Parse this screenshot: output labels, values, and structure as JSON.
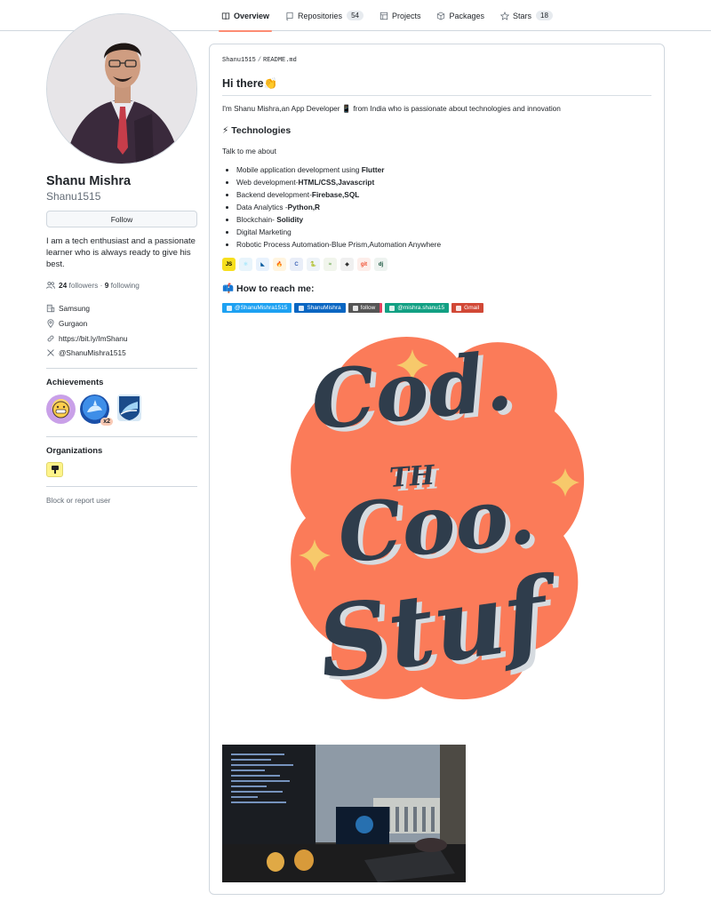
{
  "nav": {
    "tabs": [
      {
        "label": "Overview",
        "icon": "book-icon",
        "selected": true
      },
      {
        "label": "Repositories",
        "icon": "repo-icon",
        "count": "54"
      },
      {
        "label": "Projects",
        "icon": "table-icon"
      },
      {
        "label": "Packages",
        "icon": "package-icon"
      },
      {
        "label": "Stars",
        "icon": "star-icon",
        "count": "18"
      }
    ]
  },
  "profile": {
    "name": "Shanu Mishra",
    "login": "Shanu1515",
    "follow_label": "Follow",
    "bio": "I am a tech enthusiast and a passionate learner who is always ready to give his best.",
    "followers_count": "24",
    "followers_label": "followers",
    "separator": "·",
    "following_count": "9",
    "following_label": "following",
    "company": "Samsung",
    "location": "Gurgaon",
    "website": "https://bit.ly/ImShanu",
    "twitter": "@ShanuMishra1515"
  },
  "achievements": {
    "title": "Achievements",
    "multiplier": "x2"
  },
  "organizations": {
    "title": "Organizations"
  },
  "block_label": "Block or report user",
  "readme": {
    "owner": "Shanu1515",
    "slash": "/",
    "file": "README.md",
    "heading": "Hi there👏",
    "intro": "I'm Shanu Mishra,an App Developer 📱 from India who is passionate about technologies and innovation",
    "tech_heading": "⚡ Technologies",
    "talk": "Talk to me about",
    "tech_items": [
      {
        "text": "Mobile application development using ",
        "bold": "Flutter"
      },
      {
        "text": "Web development-",
        "bold": "HTML/CSS,Javascript"
      },
      {
        "text": "Backend development-",
        "bold": "Firebase,SQL"
      },
      {
        "text": "Data Analytics -",
        "bold": "Python,R"
      },
      {
        "text": "Blockchain- ",
        "bold": "Solidity"
      },
      {
        "text": "Digital Marketing",
        "bold": ""
      },
      {
        "text": "Robotic Process Automation-Blue Prism,Automation Anywhere",
        "bold": ""
      }
    ],
    "tech_icons": [
      {
        "label": "JS",
        "color": "#f7df1e",
        "fg": "#000000"
      },
      {
        "label": "⚛",
        "color": "#e8f4fb",
        "fg": "#61dafb"
      },
      {
        "label": "◣",
        "color": "#e8f2fd",
        "fg": "#02569b"
      },
      {
        "label": "🔥",
        "color": "#fff5e0",
        "fg": "#ffa000"
      },
      {
        "label": "C",
        "color": "#e9eef8",
        "fg": "#3e64b6"
      },
      {
        "label": "🐍",
        "color": "#eef3f8",
        "fg": "#3776ab"
      },
      {
        "label": "≈",
        "color": "#f1f5ec",
        "fg": "#6aa84f"
      },
      {
        "label": "◆",
        "color": "#f0f0f0",
        "fg": "#333333"
      },
      {
        "label": "git",
        "color": "#fdeeea",
        "fg": "#f05032"
      },
      {
        "label": "dj",
        "color": "#eef3f0",
        "fg": "#0c4b33"
      }
    ],
    "reach_heading": "📫 How to reach me:",
    "shields": [
      {
        "label": "@ShanuMishra1515",
        "color": "#1da1f2",
        "icon": "twitter-icon"
      },
      {
        "label": "ShanuMishra",
        "color": "#0a66c2",
        "icon": "linkedin-icon"
      },
      {
        "label": "follow",
        "color": "#555555",
        "icon": "instagram-icon",
        "accent": "#e4405f"
      },
      {
        "label": "@mishra.shanu15",
        "color": "#12a083",
        "icon": "medium-icon"
      },
      {
        "label": "Gmail",
        "color": "#d14836",
        "icon": "gmail-icon"
      }
    ],
    "sticker_text": [
      "Cod.",
      "TH",
      "Coo.",
      "Stuf"
    ],
    "sticker_colors": {
      "blob": "#fb7b59",
      "text": "#2f3d4c",
      "shadow": "#d6dbe0",
      "stars": "#f7c96b"
    }
  }
}
